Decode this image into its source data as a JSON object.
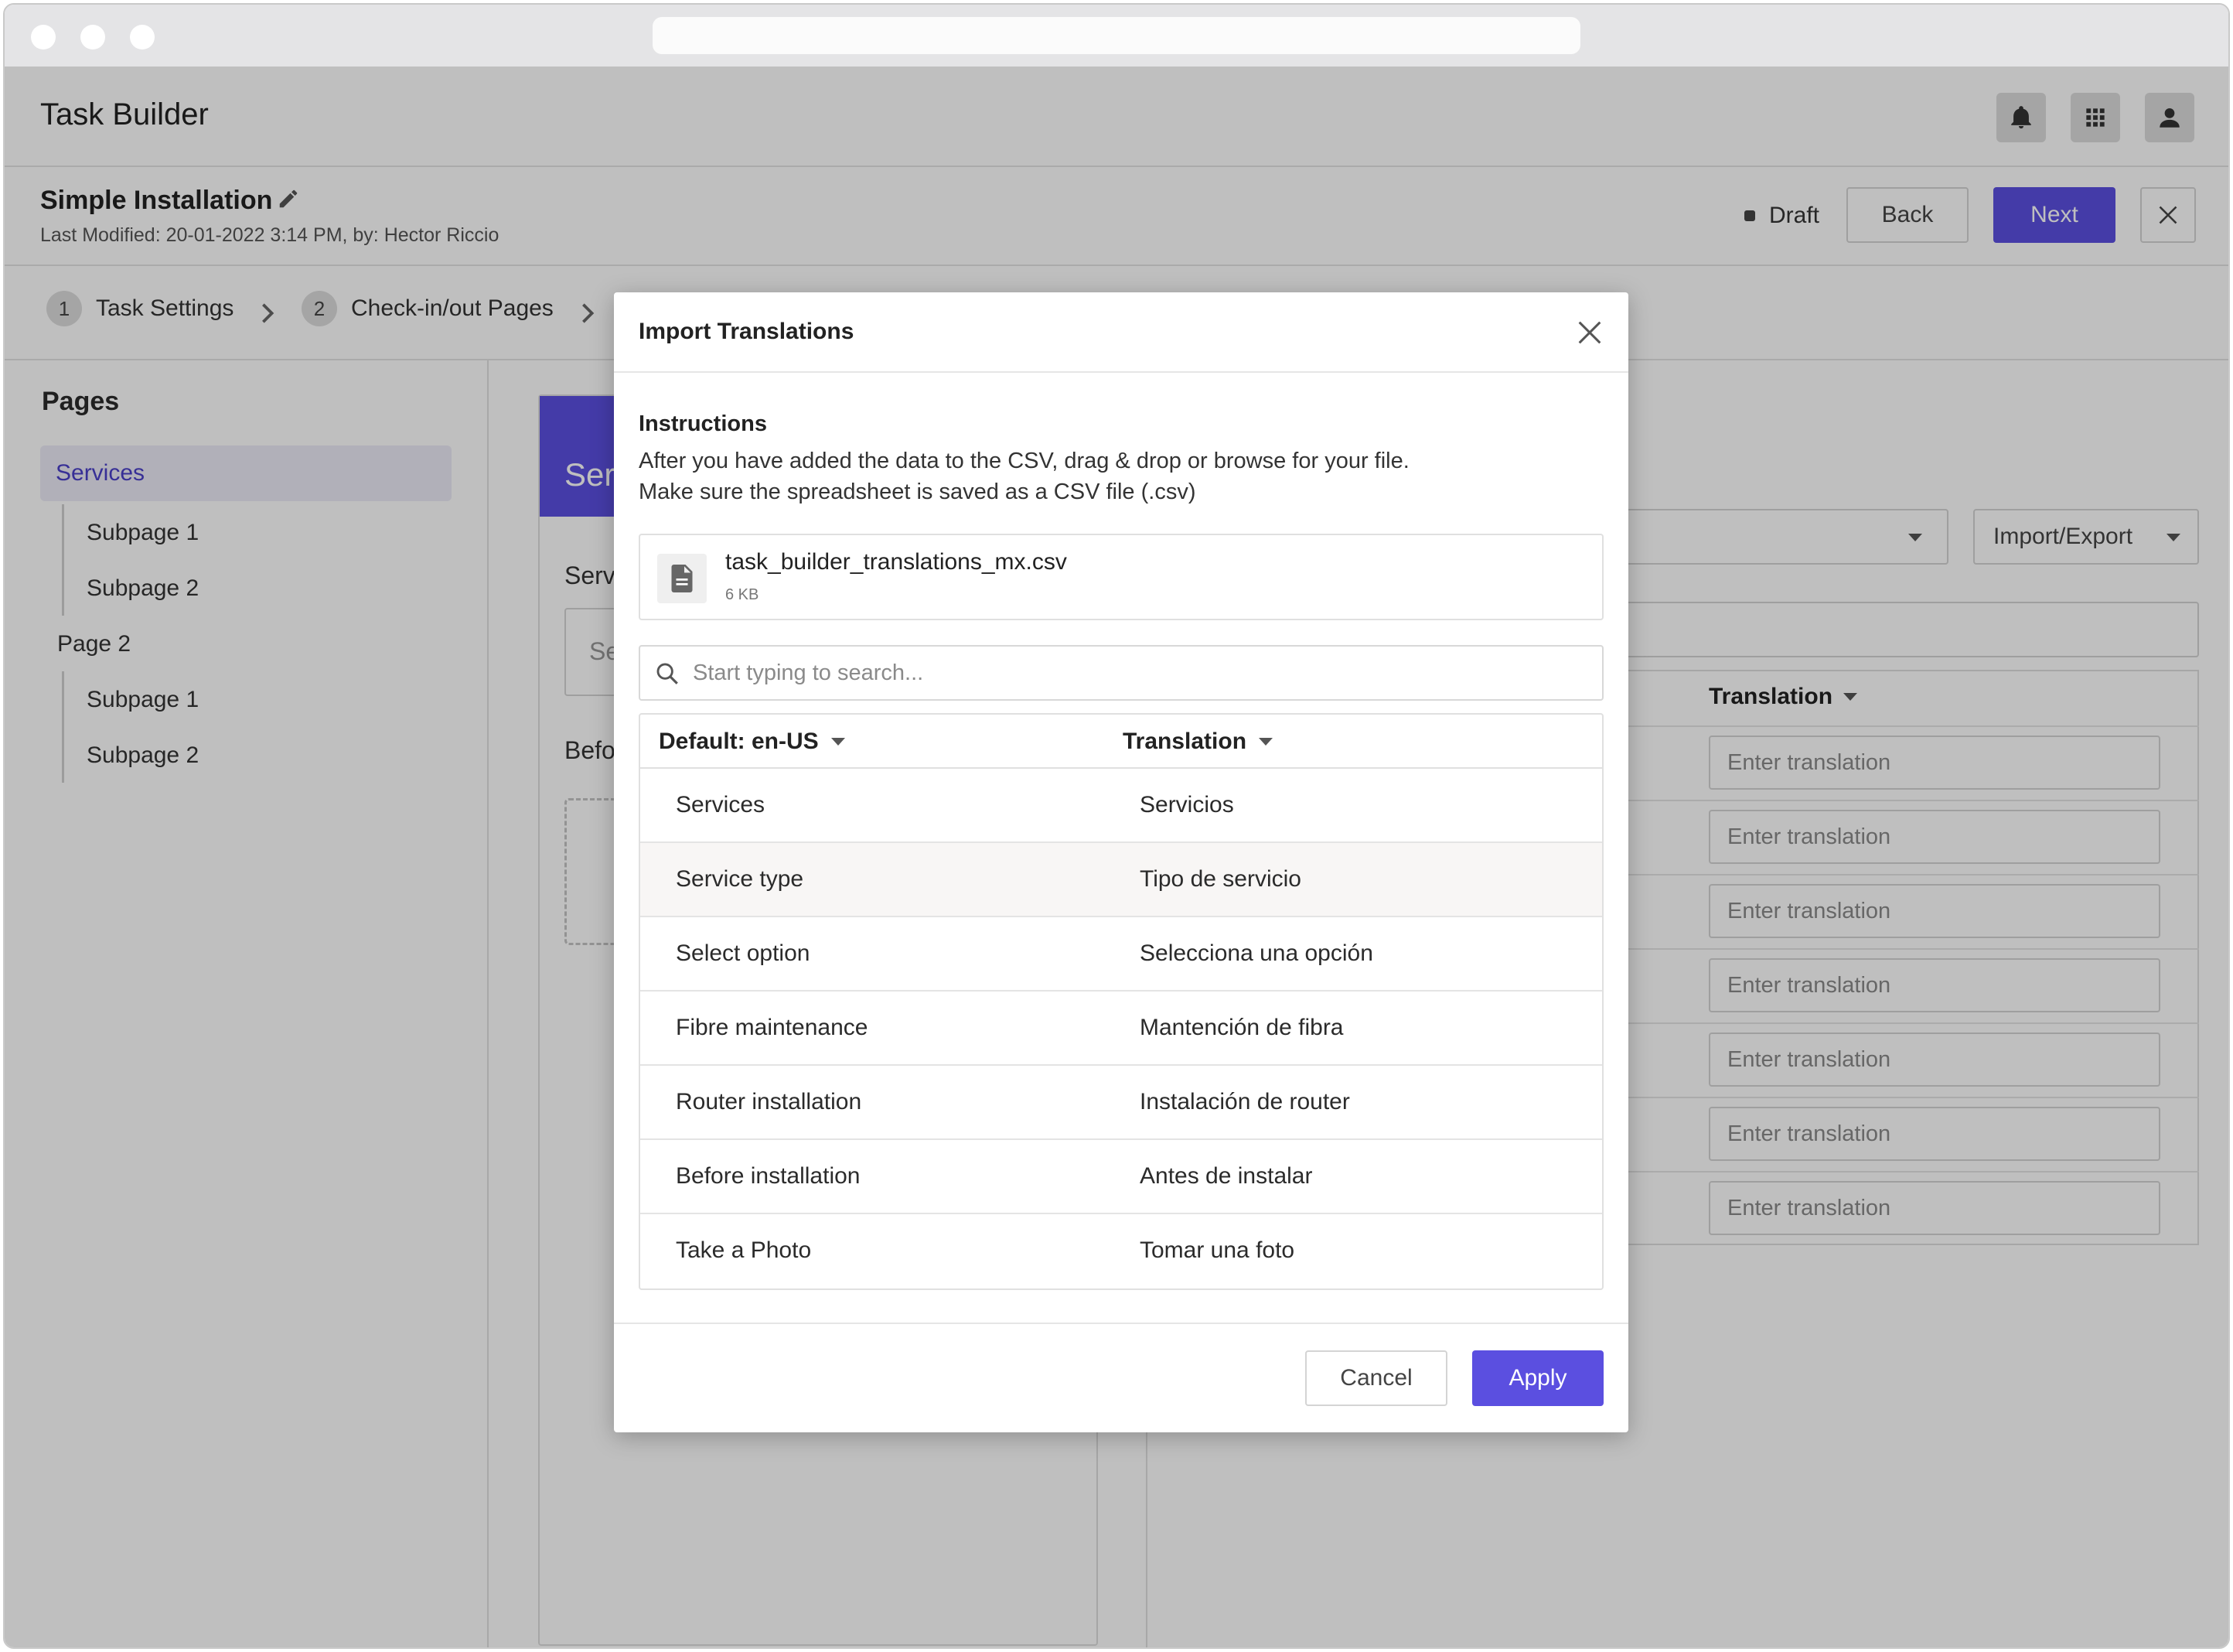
{
  "app": {
    "title": "Task Builder"
  },
  "project": {
    "title": "Simple Installation",
    "modified": "Last Modified: 20-01-2022 3:14 PM, by: Hector Riccio",
    "status": "Draft",
    "back_label": "Back",
    "next_label": "Next"
  },
  "steps": [
    {
      "num": "1",
      "label": "Task Settings"
    },
    {
      "num": "2",
      "label": "Check-in/out Pages"
    }
  ],
  "pages": {
    "title": "Pages",
    "items": [
      {
        "label": "Services"
      },
      {
        "label": "Subpage 1"
      },
      {
        "label": "Subpage 2"
      },
      {
        "label": "Page 2"
      },
      {
        "label": "Subpage 1"
      },
      {
        "label": "Subpage 2"
      }
    ]
  },
  "editor": {
    "header_partial": "Ser",
    "field_label_partial": "Serv",
    "input_partial": "Se",
    "section_partial": "Befo"
  },
  "background_table": {
    "import_export_label": "Import/Export",
    "translation_header": "Translation",
    "placeholder": "Enter translation"
  },
  "modal": {
    "title": "Import Translations",
    "instructions_title": "Instructions",
    "instructions_line1": "After you have added the data to the CSV, drag & drop or browse for your file.",
    "instructions_line2": "Make sure the spreadsheet is saved as a CSV file (.csv)",
    "file_name": "task_builder_translations_mx.csv",
    "file_size": "6 KB",
    "search_placeholder": "Start typing to search...",
    "col_default": "Default: en-US",
    "col_translation": "Translation",
    "rows": [
      {
        "source": "Services",
        "target": "Servicios"
      },
      {
        "source": "Service type",
        "target": "Tipo de servicio"
      },
      {
        "source": "Select option",
        "target": "Selecciona una opción"
      },
      {
        "source": "Fibre maintenance",
        "target": "Mantención de fibra"
      },
      {
        "source": "Router installation",
        "target": "Instalación de router"
      },
      {
        "source": "Before installation",
        "target": "Antes de instalar"
      },
      {
        "source": "Take a Photo",
        "target": "Tomar una foto"
      }
    ],
    "cancel_label": "Cancel",
    "apply_label": "Apply"
  },
  "colors": {
    "accent": "#5b4fe0",
    "overlay": "rgba(0,0,0,0.25)"
  }
}
